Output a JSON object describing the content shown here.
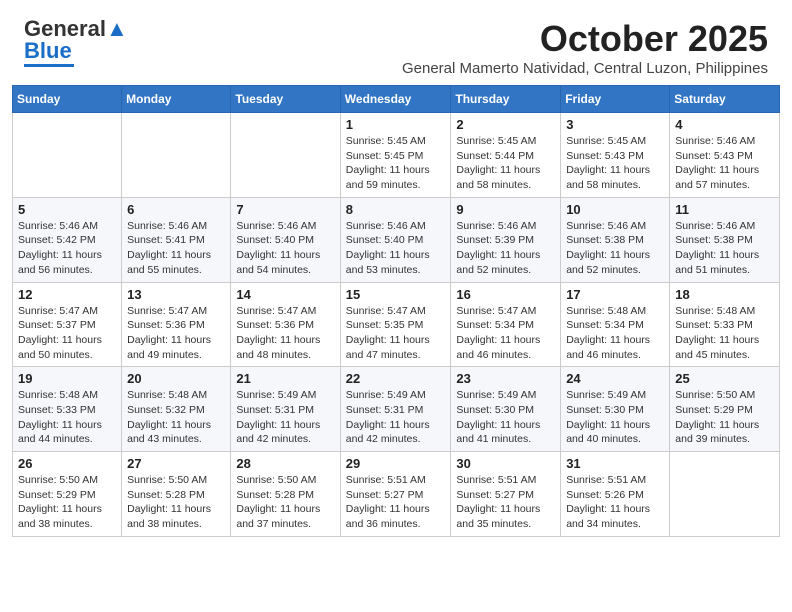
{
  "header": {
    "logo_general": "General",
    "logo_blue": "Blue",
    "month": "October 2025",
    "location": "General Mamerto Natividad, Central Luzon, Philippines"
  },
  "weekdays": [
    "Sunday",
    "Monday",
    "Tuesday",
    "Wednesday",
    "Thursday",
    "Friday",
    "Saturday"
  ],
  "weeks": [
    [
      {
        "day": "",
        "info": ""
      },
      {
        "day": "",
        "info": ""
      },
      {
        "day": "",
        "info": ""
      },
      {
        "day": "1",
        "info": "Sunrise: 5:45 AM\nSunset: 5:45 PM\nDaylight: 11 hours and 59 minutes."
      },
      {
        "day": "2",
        "info": "Sunrise: 5:45 AM\nSunset: 5:44 PM\nDaylight: 11 hours and 58 minutes."
      },
      {
        "day": "3",
        "info": "Sunrise: 5:45 AM\nSunset: 5:43 PM\nDaylight: 11 hours and 58 minutes."
      },
      {
        "day": "4",
        "info": "Sunrise: 5:46 AM\nSunset: 5:43 PM\nDaylight: 11 hours and 57 minutes."
      }
    ],
    [
      {
        "day": "5",
        "info": "Sunrise: 5:46 AM\nSunset: 5:42 PM\nDaylight: 11 hours and 56 minutes."
      },
      {
        "day": "6",
        "info": "Sunrise: 5:46 AM\nSunset: 5:41 PM\nDaylight: 11 hours and 55 minutes."
      },
      {
        "day": "7",
        "info": "Sunrise: 5:46 AM\nSunset: 5:40 PM\nDaylight: 11 hours and 54 minutes."
      },
      {
        "day": "8",
        "info": "Sunrise: 5:46 AM\nSunset: 5:40 PM\nDaylight: 11 hours and 53 minutes."
      },
      {
        "day": "9",
        "info": "Sunrise: 5:46 AM\nSunset: 5:39 PM\nDaylight: 11 hours and 52 minutes."
      },
      {
        "day": "10",
        "info": "Sunrise: 5:46 AM\nSunset: 5:38 PM\nDaylight: 11 hours and 52 minutes."
      },
      {
        "day": "11",
        "info": "Sunrise: 5:46 AM\nSunset: 5:38 PM\nDaylight: 11 hours and 51 minutes."
      }
    ],
    [
      {
        "day": "12",
        "info": "Sunrise: 5:47 AM\nSunset: 5:37 PM\nDaylight: 11 hours and 50 minutes."
      },
      {
        "day": "13",
        "info": "Sunrise: 5:47 AM\nSunset: 5:36 PM\nDaylight: 11 hours and 49 minutes."
      },
      {
        "day": "14",
        "info": "Sunrise: 5:47 AM\nSunset: 5:36 PM\nDaylight: 11 hours and 48 minutes."
      },
      {
        "day": "15",
        "info": "Sunrise: 5:47 AM\nSunset: 5:35 PM\nDaylight: 11 hours and 47 minutes."
      },
      {
        "day": "16",
        "info": "Sunrise: 5:47 AM\nSunset: 5:34 PM\nDaylight: 11 hours and 46 minutes."
      },
      {
        "day": "17",
        "info": "Sunrise: 5:48 AM\nSunset: 5:34 PM\nDaylight: 11 hours and 46 minutes."
      },
      {
        "day": "18",
        "info": "Sunrise: 5:48 AM\nSunset: 5:33 PM\nDaylight: 11 hours and 45 minutes."
      }
    ],
    [
      {
        "day": "19",
        "info": "Sunrise: 5:48 AM\nSunset: 5:33 PM\nDaylight: 11 hours and 44 minutes."
      },
      {
        "day": "20",
        "info": "Sunrise: 5:48 AM\nSunset: 5:32 PM\nDaylight: 11 hours and 43 minutes."
      },
      {
        "day": "21",
        "info": "Sunrise: 5:49 AM\nSunset: 5:31 PM\nDaylight: 11 hours and 42 minutes."
      },
      {
        "day": "22",
        "info": "Sunrise: 5:49 AM\nSunset: 5:31 PM\nDaylight: 11 hours and 42 minutes."
      },
      {
        "day": "23",
        "info": "Sunrise: 5:49 AM\nSunset: 5:30 PM\nDaylight: 11 hours and 41 minutes."
      },
      {
        "day": "24",
        "info": "Sunrise: 5:49 AM\nSunset: 5:30 PM\nDaylight: 11 hours and 40 minutes."
      },
      {
        "day": "25",
        "info": "Sunrise: 5:50 AM\nSunset: 5:29 PM\nDaylight: 11 hours and 39 minutes."
      }
    ],
    [
      {
        "day": "26",
        "info": "Sunrise: 5:50 AM\nSunset: 5:29 PM\nDaylight: 11 hours and 38 minutes."
      },
      {
        "day": "27",
        "info": "Sunrise: 5:50 AM\nSunset: 5:28 PM\nDaylight: 11 hours and 38 minutes."
      },
      {
        "day": "28",
        "info": "Sunrise: 5:50 AM\nSunset: 5:28 PM\nDaylight: 11 hours and 37 minutes."
      },
      {
        "day": "29",
        "info": "Sunrise: 5:51 AM\nSunset: 5:27 PM\nDaylight: 11 hours and 36 minutes."
      },
      {
        "day": "30",
        "info": "Sunrise: 5:51 AM\nSunset: 5:27 PM\nDaylight: 11 hours and 35 minutes."
      },
      {
        "day": "31",
        "info": "Sunrise: 5:51 AM\nSunset: 5:26 PM\nDaylight: 11 hours and 34 minutes."
      },
      {
        "day": "",
        "info": ""
      }
    ]
  ]
}
